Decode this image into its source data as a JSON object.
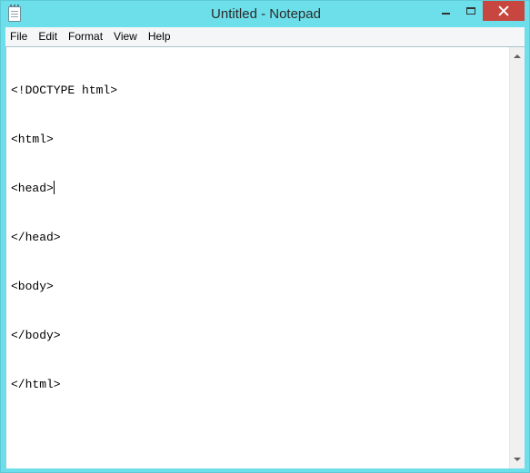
{
  "window": {
    "title": "Untitled - Notepad",
    "icon": "notepad-icon",
    "controls": {
      "minimize_icon": "minimize-icon",
      "maximize_icon": "maximize-icon",
      "close_icon": "close-icon"
    }
  },
  "menubar": {
    "items": [
      {
        "label": "File"
      },
      {
        "label": "Edit"
      },
      {
        "label": "Format"
      },
      {
        "label": "View"
      },
      {
        "label": "Help"
      }
    ]
  },
  "editor": {
    "lines": [
      "<!DOCTYPE html>",
      "<html>",
      "<head>",
      "</head>",
      "<body>",
      "</body>",
      "</html>"
    ],
    "caret_line": 3
  },
  "colors": {
    "title_bar": "#6ddfea",
    "close_button": "#c7463f",
    "menu_bar": "#f5f6f7",
    "editor_background": "#ffffff"
  }
}
